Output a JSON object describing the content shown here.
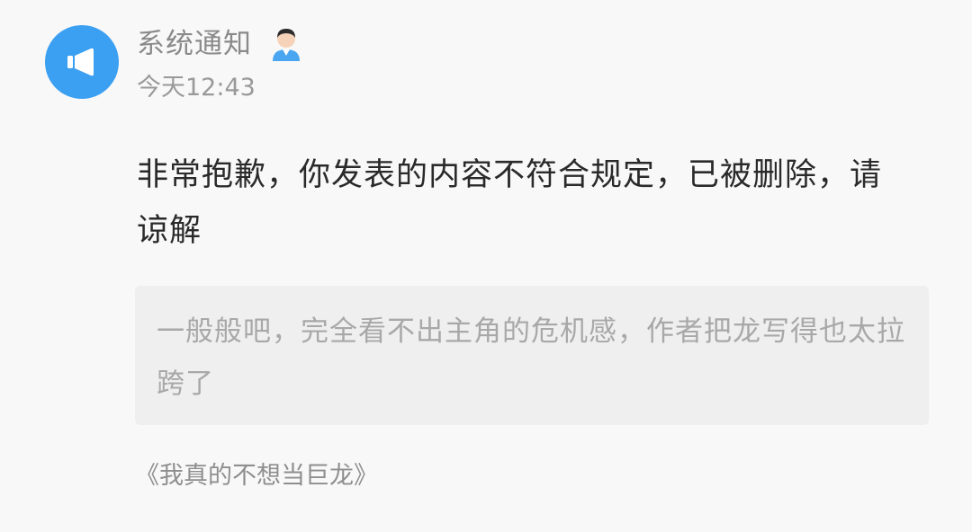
{
  "notification": {
    "sender": "系统通知",
    "time": "今天12:43",
    "avatar_icon": "speaker-icon",
    "badge_icon": "person-icon",
    "avatar_color": "#3b9ff2",
    "message": "非常抱歉，你发表的内容不符合规定，已被删除，请谅解",
    "quoted_comment": "一般般吧，完全看不出主角的危机感，作者把龙写得也太拉跨了",
    "book_title": "《我真的不想当巨龙》"
  }
}
